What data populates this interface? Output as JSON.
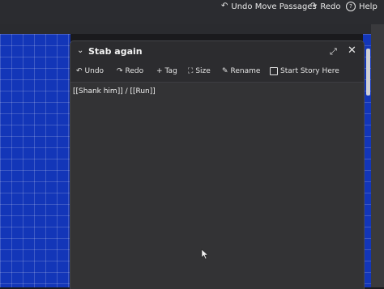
{
  "topbar": {
    "undo_label": "Undo Move Passages",
    "redo_label": "Redo",
    "help_label": "Help",
    "icons": [
      "undo-icon",
      "redo-icon",
      "help-icon"
    ]
  },
  "dialog": {
    "title": "Stab again",
    "toolbar": {
      "undo": "Undo",
      "redo": "Redo",
      "tag": "Tag",
      "size": "Size",
      "rename": "Rename",
      "start": "Start Story Here"
    },
    "text": "[[Shank him]] / [[Run]]"
  },
  "colors": {
    "grid_blue": "#1336b8",
    "dialog_bg": "#2c2c2f",
    "text_bg": "#333335"
  }
}
